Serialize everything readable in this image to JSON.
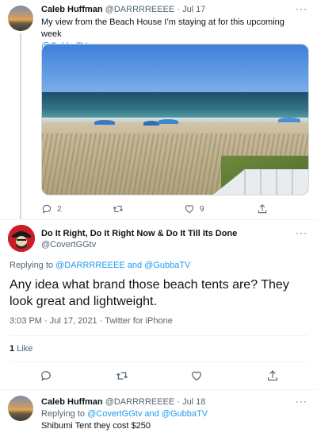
{
  "tweet1": {
    "name": "Caleb Huffman",
    "handle": "@DARRRREEEE",
    "date": "Jul 17",
    "separator": "·",
    "text": "My view from the Beach House I’m staying at for this upcoming week",
    "mention": "@GubbaTV",
    "replies": "2",
    "retweets": "",
    "likes": "9"
  },
  "tweet2": {
    "name": "Do It Right, Do It Right Now & Do It Till Its Done",
    "handle": "@CovertGGtv",
    "replying_prefix": "Replying to",
    "replying_mentions": "@DARRRREEEE and @GubbaTV",
    "text": "Any idea what brand those beach tents are?  They look great and lightweight.",
    "meta": "3:03 PM · Jul 17, 2021 · Twitter for iPhone",
    "like_count": "1",
    "like_label": "Like"
  },
  "tweet3": {
    "name": "Caleb Huffman",
    "handle": "@DARRRREEEE",
    "date": "Jul 18",
    "separator": "·",
    "replying_prefix": "Replying to",
    "replying_mentions": "@CovertGGtv and @GubbaTV",
    "text": "Shibumi Tent they cost $250"
  },
  "more_label": "···",
  "colors": {
    "link": "#1d9bf0",
    "muted": "#536471",
    "text": "#0f1419"
  },
  "icons": [
    "reply-icon",
    "retweet-icon",
    "like-icon",
    "share-icon",
    "more-icon"
  ]
}
